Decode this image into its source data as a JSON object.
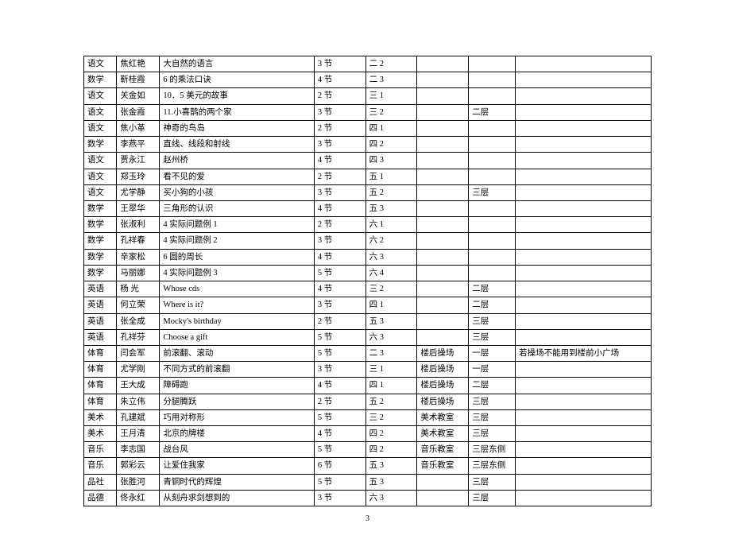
{
  "page_number": "3",
  "rows": [
    {
      "subject": "语文",
      "teacher": "焦红艳",
      "topic": "大自然的语言",
      "period": "3 节",
      "class": "二 2",
      "venue": "",
      "floor": "",
      "note": ""
    },
    {
      "subject": "数学",
      "teacher": "靳桂霞",
      "topic": "6 的乘法口诀",
      "period": "4 节",
      "class": "二 3",
      "venue": "",
      "floor": "",
      "note": ""
    },
    {
      "subject": "语文",
      "teacher": "关金如",
      "topic": "10．5 美元的故事",
      "period": "2 节",
      "class": "三 1",
      "venue": "",
      "floor": "",
      "note": ""
    },
    {
      "subject": "语文",
      "teacher": "张金霞",
      "topic": "11.小喜鹊的两个家",
      "period": "3 节",
      "class": "三 2",
      "venue": "",
      "floor": "二层",
      "note": ""
    },
    {
      "subject": "语文",
      "teacher": "焦小革",
      "topic": "神奇的鸟岛",
      "period": "2 节",
      "class": "四 1",
      "venue": "",
      "floor": "",
      "note": ""
    },
    {
      "subject": "数学",
      "teacher": "李燕平",
      "topic": "直线、线段和射线",
      "period": "3 节",
      "class": "四 2",
      "venue": "",
      "floor": "",
      "note": ""
    },
    {
      "subject": "语文",
      "teacher": "贾永江",
      "topic": "赵州桥",
      "period": "4 节",
      "class": "四 3",
      "venue": "",
      "floor": "",
      "note": ""
    },
    {
      "subject": "语文",
      "teacher": "郑玉玲",
      "topic": "看不见的爱",
      "period": "2 节",
      "class": "五 1",
      "venue": "",
      "floor": "",
      "note": ""
    },
    {
      "subject": "语文",
      "teacher": "尤学静",
      "topic": "买小狗的小孩",
      "period": "3 节",
      "class": "五 2",
      "venue": "",
      "floor": "三层",
      "note": ""
    },
    {
      "subject": "数学",
      "teacher": "王翠华",
      "topic": "三角形的认识",
      "period": "4 节",
      "class": "五 3",
      "venue": "",
      "floor": "",
      "note": ""
    },
    {
      "subject": "数学",
      "teacher": "张淑利",
      "topic": "4 实际问题例 1",
      "period": "2 节",
      "class": "六 1",
      "venue": "",
      "floor": "",
      "note": ""
    },
    {
      "subject": "数学",
      "teacher": "孔祥春",
      "topic": "4 实际问题例 2",
      "period": "3 节",
      "class": "六 2",
      "venue": "",
      "floor": "",
      "note": ""
    },
    {
      "subject": "数学",
      "teacher": "辛家松",
      "topic": "6 圆的周长",
      "period": "4 节",
      "class": "六 3",
      "venue": "",
      "floor": "",
      "note": ""
    },
    {
      "subject": "数学",
      "teacher": "马丽娜",
      "topic": "4 实际问题例 3",
      "period": "5 节",
      "class": "六 4",
      "venue": "",
      "floor": "",
      "note": ""
    },
    {
      "subject": "英语",
      "teacher": "杨   光",
      "topic": "Whose   cds",
      "period": "4 节",
      "class": "三 2",
      "venue": "",
      "floor": "二层",
      "note": ""
    },
    {
      "subject": "英语",
      "teacher": "何立荣",
      "topic": "Where   is   it?",
      "period": "3 节",
      "class": "四 1",
      "venue": "",
      "floor": "二层",
      "note": ""
    },
    {
      "subject": "英语",
      "teacher": "张全成",
      "topic": "Mocky's   birthday",
      "period": "2 节",
      "class": "五 3",
      "venue": "",
      "floor": "三层",
      "note": ""
    },
    {
      "subject": "英语",
      "teacher": "孔祥芬",
      "topic": "Choose   a   gift",
      "period": "5 节",
      "class": "六 3",
      "venue": "",
      "floor": "三层",
      "note": ""
    },
    {
      "subject": "体育",
      "teacher": "闫会军",
      "topic": "前滚翻、滚动",
      "period": "5 节",
      "class": "二 3",
      "venue": "楼后操场",
      "floor": "一层",
      "note": "若操场不能用到楼前小广场"
    },
    {
      "subject": "体育",
      "teacher": "尤学刚",
      "topic": "不同方式的前滚翻",
      "period": "3 节",
      "class": "三 1",
      "venue": "楼后操场",
      "floor": "一层",
      "note": ""
    },
    {
      "subject": "体育",
      "teacher": "王大成",
      "topic": "障碍跑",
      "period": "4 节",
      "class": "四 1",
      "venue": "楼后操场",
      "floor": "二层",
      "note": ""
    },
    {
      "subject": "体育",
      "teacher": "朱立伟",
      "topic": "分腿腾跃",
      "period": "2 节",
      "class": "五 2",
      "venue": "楼后操场",
      "floor": "三层",
      "note": ""
    },
    {
      "subject": "美术",
      "teacher": "孔建斌",
      "topic": "巧用对称形",
      "period": "5 节",
      "class": "三 2",
      "venue": "美术教室",
      "floor": "三层",
      "note": ""
    },
    {
      "subject": "美术",
      "teacher": "王月清",
      "topic": "北京的牌楼",
      "period": "4 节",
      "class": "四 2",
      "venue": "美术教室",
      "floor": "三层",
      "note": ""
    },
    {
      "subject": "音乐",
      "teacher": "李志国",
      "topic": "战台风",
      "period": "5 节",
      "class": "四 2",
      "venue": "音乐教室",
      "floor": "三层东侧",
      "note": ""
    },
    {
      "subject": "音乐",
      "teacher": "郭彩云",
      "topic": "让爱住我家",
      "period": "6 节",
      "class": "五 3",
      "venue": "音乐教室",
      "floor": "三层东侧",
      "note": ""
    },
    {
      "subject": "品社",
      "teacher": "张胜河",
      "topic": "青铜时代的辉煌",
      "period": "5 节",
      "class": "五 3",
      "venue": "",
      "floor": "三层",
      "note": ""
    },
    {
      "subject": "品德",
      "teacher": "佟永红",
      "topic": "从刻舟求剑想到的",
      "period": "3 节",
      "class": "六 3",
      "venue": "",
      "floor": "三层",
      "note": ""
    }
  ]
}
